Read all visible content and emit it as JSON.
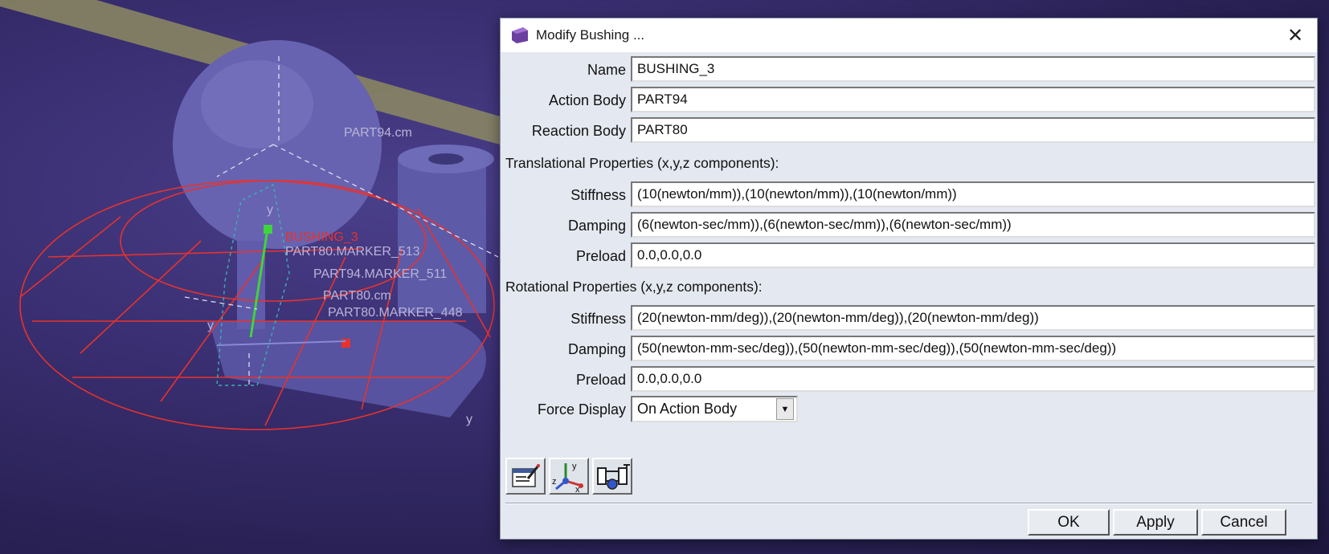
{
  "viewport": {
    "labels": {
      "part94_cm": "PART94.cm",
      "bushing": "BUSHING_3",
      "marker_513": "PART80.MARKER_513",
      "marker_511": "PART94.MARKER_511",
      "part80_cm": "PART80.cm",
      "marker_448": "PART80.MARKER_448",
      "axis_y1": "y",
      "axis_y2": "y",
      "axis_y3": "y"
    }
  },
  "dialog": {
    "title": "Modify Bushing ...",
    "close_glyph": "✕",
    "fields": {
      "name": {
        "label": "Name",
        "value": "BUSHING_3"
      },
      "action_body": {
        "label": "Action Body",
        "value": "PART94"
      },
      "reaction_body": {
        "label": "Reaction Body",
        "value": "PART80"
      }
    },
    "translational": {
      "heading": "Translational Properties (x,y,z components):",
      "stiffness": {
        "label": "Stiffness",
        "value": "(10(newton/mm)),(10(newton/mm)),(10(newton/mm))"
      },
      "damping": {
        "label": "Damping",
        "value": "(6(newton-sec/mm)),(6(newton-sec/mm)),(6(newton-sec/mm))"
      },
      "preload": {
        "label": "Preload",
        "value": "0.0,0.0,0.0"
      }
    },
    "rotational": {
      "heading": "Rotational Properties (x,y,z components):",
      "stiffness": {
        "label": "Stiffness",
        "value": "(20(newton-mm/deg)),(20(newton-mm/deg)),(20(newton-mm/deg))"
      },
      "damping": {
        "label": "Damping",
        "value": "(50(newton-mm-sec/deg)),(50(newton-mm-sec/deg)),(50(newton-mm-sec/deg))"
      },
      "preload": {
        "label": "Preload",
        "value": "0.0,0.0,0.0"
      }
    },
    "force_display": {
      "label": "Force Display",
      "value": "On Action Body"
    },
    "toolbar": {
      "icons": [
        "edit-properties-icon",
        "coordinate-axes-icon",
        "bushing-icon"
      ],
      "axis_x": "x",
      "axis_y": "y",
      "axis_z": "z"
    },
    "buttons": {
      "ok": "OK",
      "apply": "Apply",
      "cancel": "Cancel"
    }
  }
}
